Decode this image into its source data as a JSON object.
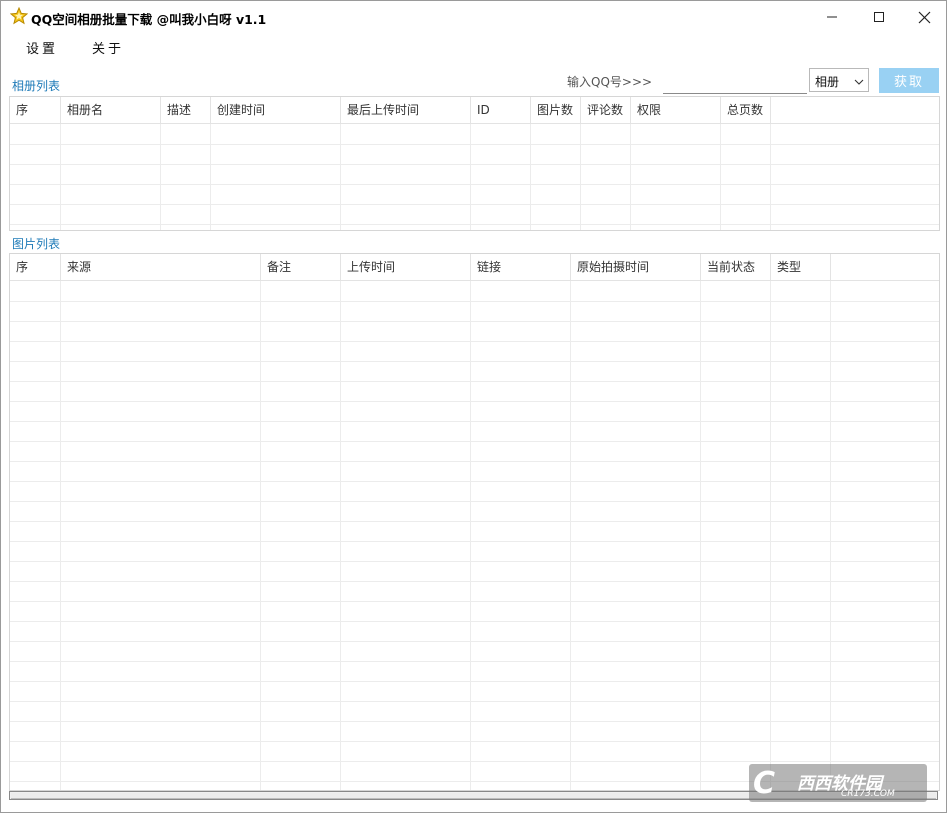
{
  "window": {
    "title": "QQ空间相册批量下载 @叫我小白呀 v1.1"
  },
  "menu": {
    "settings": "设置",
    "about": "关于"
  },
  "album_section": {
    "label": "相册列表",
    "columns": [
      "序",
      "相册名",
      "描述",
      "创建时间",
      "最后上传时间",
      "ID",
      "图片数",
      "评论数",
      "权限",
      "总页数"
    ]
  },
  "qq": {
    "label": "输入QQ号>>>",
    "value": "",
    "placeholder": ""
  },
  "type_select": {
    "selected": "相册"
  },
  "fetch_button": "获取",
  "photo_section": {
    "label": "图片列表",
    "columns": [
      "序",
      "来源",
      "备注",
      "上传时间",
      "链接",
      "原始拍摄时间",
      "当前状态",
      "类型"
    ]
  },
  "watermark": {
    "text": "西西软件园",
    "sub": "CR173.COM",
    "color": "#7a7a7a"
  },
  "colors": {
    "accent": "#1f7bb8",
    "button": "#99d1f3"
  }
}
